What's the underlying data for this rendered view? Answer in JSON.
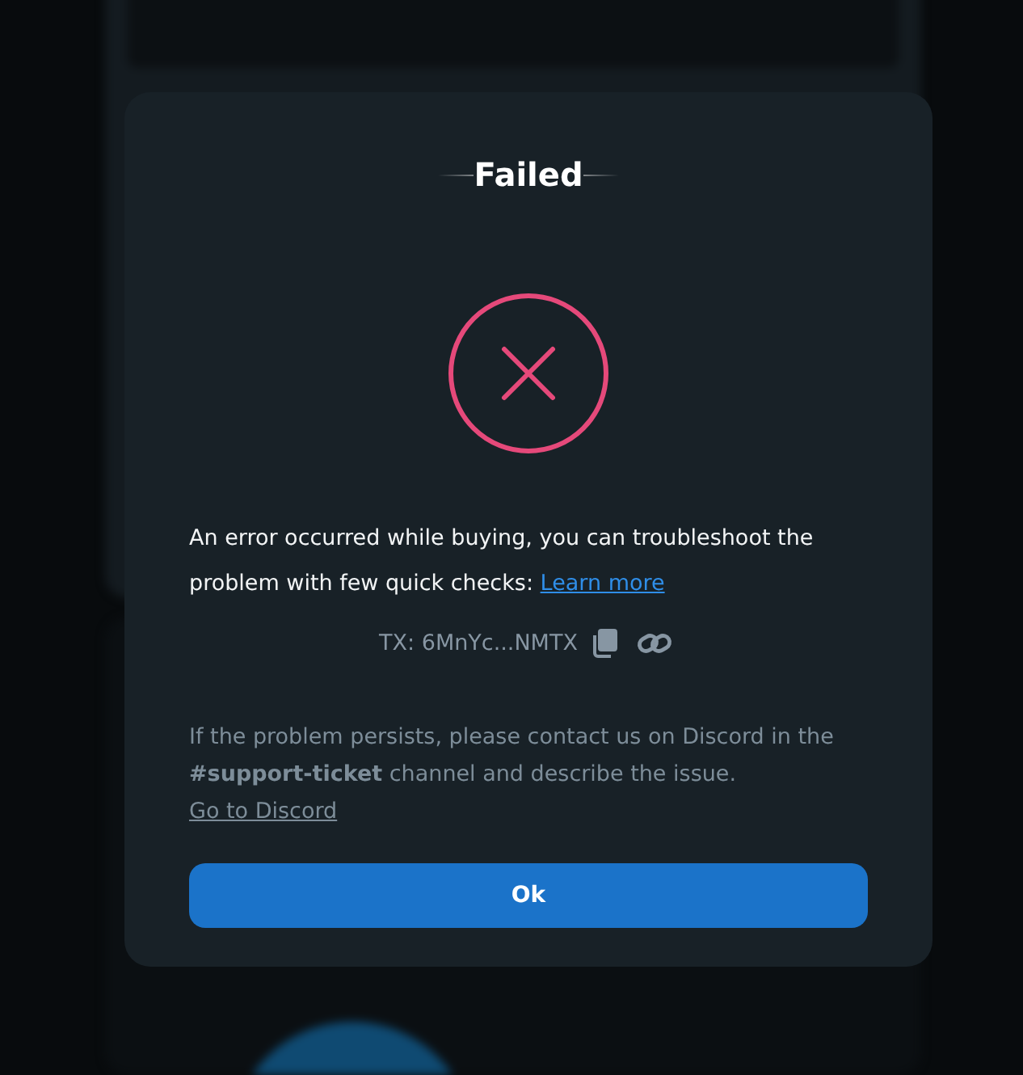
{
  "dialog": {
    "title": "Failed",
    "message": "An error occurred while buying, you can troubleshoot the problem with few quick checks:",
    "learn_more_link": "Learn more",
    "tx_label": "TX: 6MnYc...NMTX",
    "support_text": "If the problem persists, please contact us on Discord in the **#support-ticket** channel and describe the issue.",
    "discord_link": "Go to Discord",
    "ok_button": "Ok"
  }
}
